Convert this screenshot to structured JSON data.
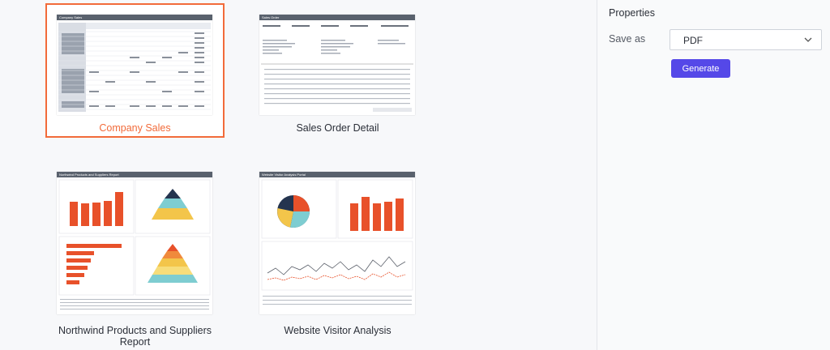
{
  "reports": [
    {
      "name": "Company Sales",
      "selected": true,
      "thumb_title": "Company Sales"
    },
    {
      "name": "Sales Order Detail",
      "selected": false,
      "thumb_title": "Sales Order"
    },
    {
      "name": "Northwind Products and Suppliers Report",
      "selected": false,
      "thumb_title": "Northwind Products and Suppliers Report"
    },
    {
      "name": "Website Visitor Analysis",
      "selected": false,
      "thumb_title": "Website Visitor Analysis Portal"
    }
  ],
  "properties": {
    "title": "Properties",
    "save_as_label": "Save as",
    "save_as_value": "PDF",
    "generate_label": "Generate"
  },
  "colors": {
    "accent_selected": "#f26b3a",
    "button": "#5548e8",
    "thumb_header": "#59616d",
    "bar": "#e8512a"
  }
}
